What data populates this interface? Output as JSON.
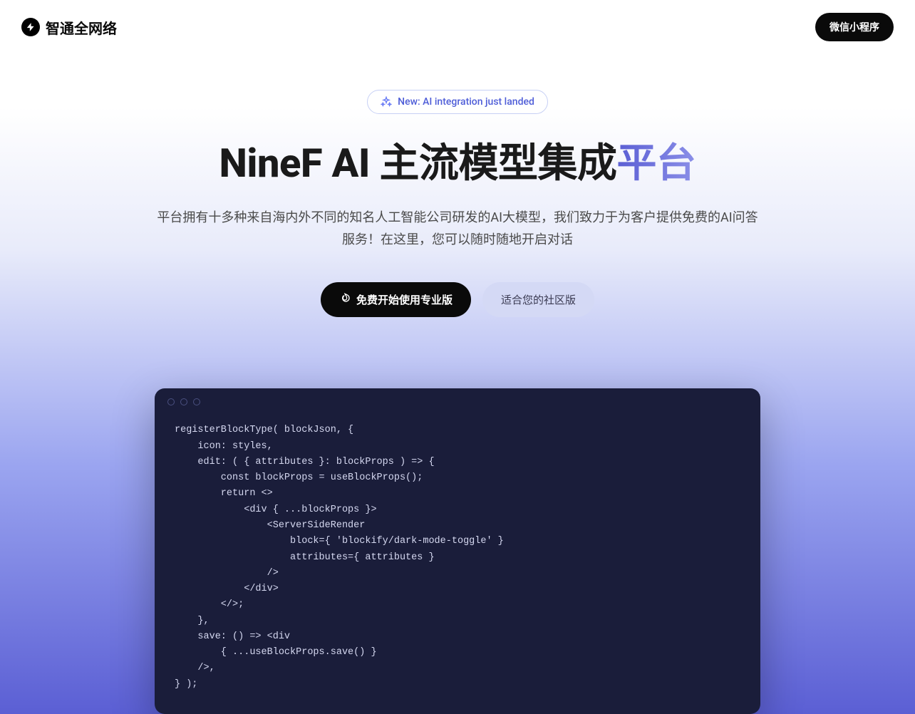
{
  "header": {
    "logo_text": "智通全网络",
    "cta_label": "微信小程序"
  },
  "hero": {
    "badge_text": "New: AI integration just landed",
    "title_main": "NineF AI 主流模型集成",
    "title_accent": "平台",
    "subtitle": "平台拥有十多种来自海内外不同的知名人工智能公司研发的AI大模型，我们致力于为客户提供免费的AI问答服务！在这里，您可以随时随地开启对话",
    "primary_btn": "免费开始使用专业版",
    "secondary_btn": "适合您的社区版"
  },
  "code": {
    "content": "registerBlockType( blockJson, {\n    icon: styles,\n    edit: ( { attributes }: blockProps ) => {\n        const blockProps = useBlockProps();\n        return <>\n            <div { ...blockProps }>\n                <ServerSideRender\n                    block={ 'blockify/dark-mode-toggle' }\n                    attributes={ attributes }\n                />\n            </div>\n        </>;\n    },\n    save: () => <div\n        { ...useBlockProps.save() }\n    />,\n} );"
  }
}
